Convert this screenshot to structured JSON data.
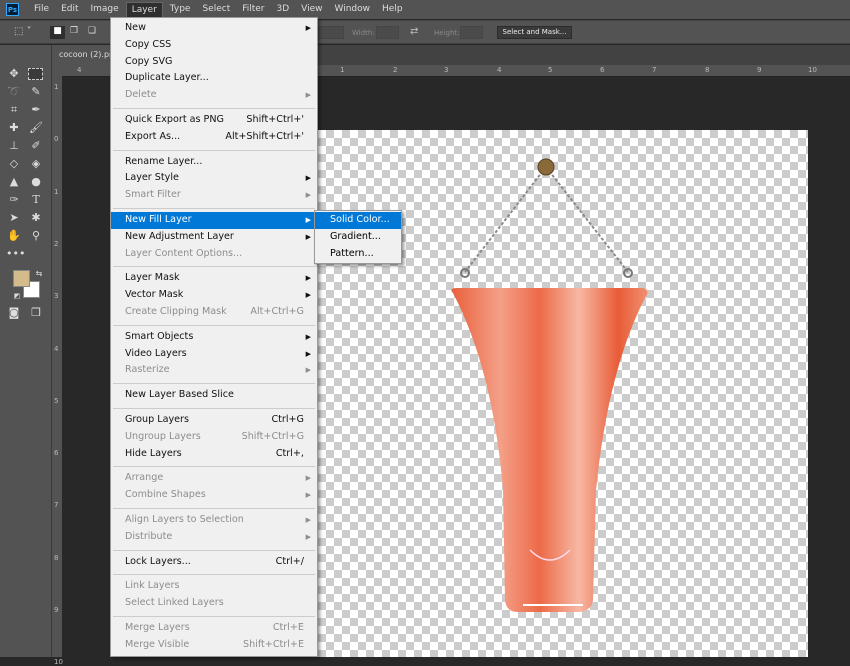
{
  "app": {
    "logo": "Ps"
  },
  "menubar": [
    "File",
    "Edit",
    "Image",
    "Layer",
    "Type",
    "Select",
    "Filter",
    "3D",
    "View",
    "Window",
    "Help"
  ],
  "options": {
    "width_label": "Width:",
    "height_label": "Height:",
    "select_mask": "Select and Mask..."
  },
  "document": {
    "tab": "cocoon (2).png"
  },
  "rulers": {
    "h": [
      "4",
      "1",
      "2",
      "3",
      "4",
      "5",
      "6",
      "7",
      "8",
      "9",
      "10"
    ],
    "v": [
      "1",
      "0",
      "1",
      "2",
      "3",
      "4",
      "5",
      "6",
      "7",
      "8",
      "9",
      "10"
    ]
  },
  "colors": {
    "foreground": "#d4bb8a",
    "background": "#ffffff",
    "highlight": "#0078d7"
  },
  "menu": [
    {
      "label": "New",
      "arrow": true
    },
    {
      "label": "Copy CSS"
    },
    {
      "label": "Copy SVG"
    },
    {
      "label": "Duplicate Layer..."
    },
    {
      "label": "Delete",
      "arrow": true,
      "disabled": true
    },
    {
      "sep": true
    },
    {
      "label": "Quick Export as PNG",
      "shortcut": "Shift+Ctrl+'"
    },
    {
      "label": "Export As...",
      "shortcut": "Alt+Shift+Ctrl+'"
    },
    {
      "sep": true
    },
    {
      "label": "Rename Layer..."
    },
    {
      "label": "Layer Style",
      "arrow": true
    },
    {
      "label": "Smart Filter",
      "arrow": true,
      "disabled": true
    },
    {
      "sep": true
    },
    {
      "label": "New Fill Layer",
      "arrow": true,
      "highlighted": true
    },
    {
      "label": "New Adjustment Layer",
      "arrow": true
    },
    {
      "label": "Layer Content Options...",
      "disabled": true
    },
    {
      "sep": true
    },
    {
      "label": "Layer Mask",
      "arrow": true
    },
    {
      "label": "Vector Mask",
      "arrow": true
    },
    {
      "label": "Create Clipping Mask",
      "shortcut": "Alt+Ctrl+G",
      "disabled": true
    },
    {
      "sep": true
    },
    {
      "label": "Smart Objects",
      "arrow": true
    },
    {
      "label": "Video Layers",
      "arrow": true
    },
    {
      "label": "Rasterize",
      "arrow": true,
      "disabled": true
    },
    {
      "sep": true
    },
    {
      "label": "New Layer Based Slice"
    },
    {
      "sep": true
    },
    {
      "label": "Group Layers",
      "shortcut": "Ctrl+G"
    },
    {
      "label": "Ungroup Layers",
      "shortcut": "Shift+Ctrl+G",
      "disabled": true
    },
    {
      "label": "Hide Layers",
      "shortcut": "Ctrl+,"
    },
    {
      "sep": true
    },
    {
      "label": "Arrange",
      "arrow": true,
      "disabled": true
    },
    {
      "label": "Combine Shapes",
      "arrow": true,
      "disabled": true
    },
    {
      "sep": true
    },
    {
      "label": "Align Layers to Selection",
      "arrow": true,
      "disabled": true
    },
    {
      "label": "Distribute",
      "arrow": true,
      "disabled": true
    },
    {
      "sep": true
    },
    {
      "label": "Lock Layers...",
      "shortcut": "Ctrl+/"
    },
    {
      "sep": true
    },
    {
      "label": "Link Layers",
      "disabled": true
    },
    {
      "label": "Select Linked Layers",
      "disabled": true
    },
    {
      "sep": true
    },
    {
      "label": "Merge Layers",
      "shortcut": "Ctrl+E",
      "disabled": true
    },
    {
      "label": "Merge Visible",
      "shortcut": "Shift+Ctrl+E",
      "disabled": true
    }
  ],
  "submenu": [
    {
      "label": "Solid Color...",
      "highlighted": true
    },
    {
      "label": "Gradient..."
    },
    {
      "label": "Pattern..."
    }
  ]
}
